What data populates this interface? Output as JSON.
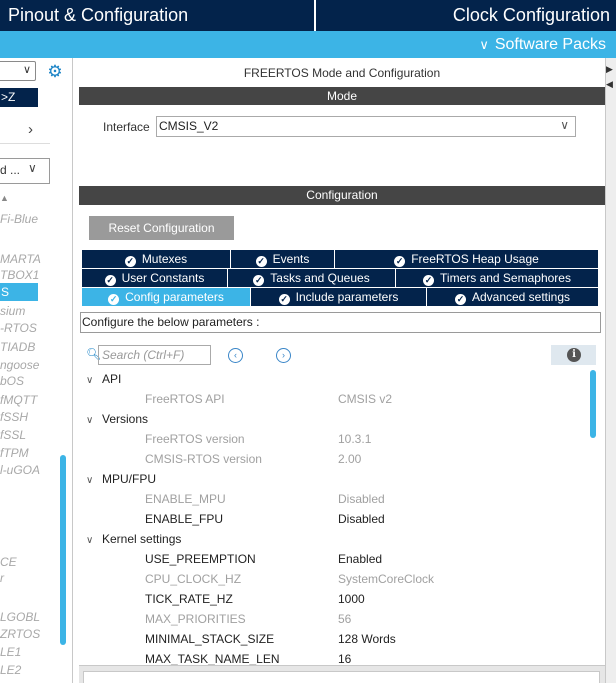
{
  "header": {
    "tab_pinout": "Pinout & Configuration",
    "tab_clock": "Clock Configuration",
    "software_packs": "Software Packs"
  },
  "left": {
    "sort_label": ">Z",
    "cat2_label": "d ...",
    "items": [
      "Fi-Blue",
      "MARTA",
      "TBOX1",
      "S",
      "sium",
      "-RTOS",
      "TIADB",
      "ngoose",
      "bOS",
      "fMQTT",
      "fSSH",
      "fSSL",
      "fTPM",
      "l-uGOA",
      "CE",
      "r",
      "LGOBL",
      "ZRTOS",
      "LE1",
      "LE2"
    ]
  },
  "mode": {
    "title": "FREERTOS Mode and Configuration",
    "bar_label": "Mode",
    "interface_label": "Interface",
    "interface_value": "CMSIS_V2"
  },
  "configuration": {
    "bar_label": "Configuration",
    "reset_button": "Reset Configuration",
    "tabs_row1": [
      "Mutexes",
      "Events",
      "FreeRTOS Heap Usage"
    ],
    "tabs_row2": [
      "User Constants",
      "Tasks and Queues",
      "Timers and Semaphores"
    ],
    "tabs_row3": [
      "Config parameters",
      "Include parameters",
      "Advanced settings"
    ],
    "params_label": "Configure the below parameters :",
    "search_placeholder": "Search (Ctrl+F)"
  },
  "tree": [
    {
      "group": "API",
      "params": [
        {
          "name": "FreeRTOS API",
          "value": "CMSIS v2",
          "active": false
        }
      ]
    },
    {
      "group": "Versions",
      "params": [
        {
          "name": "FreeRTOS version",
          "value": "10.3.1",
          "active": false
        },
        {
          "name": "CMSIS-RTOS version",
          "value": "2.00",
          "active": false
        }
      ]
    },
    {
      "group": "MPU/FPU",
      "params": [
        {
          "name": "ENABLE_MPU",
          "value": "Disabled",
          "active": false
        },
        {
          "name": "ENABLE_FPU",
          "value": "Disabled",
          "active": true
        }
      ]
    },
    {
      "group": "Kernel settings",
      "params": [
        {
          "name": "USE_PREEMPTION",
          "value": "Enabled",
          "active": true
        },
        {
          "name": "CPU_CLOCK_HZ",
          "value": "SystemCoreClock",
          "active": false
        },
        {
          "name": "TICK_RATE_HZ",
          "value": "1000",
          "active": true
        },
        {
          "name": "MAX_PRIORITIES",
          "value": "56",
          "active": false
        },
        {
          "name": "MINIMAL_STACK_SIZE",
          "value": "128 Words",
          "active": true
        },
        {
          "name": "MAX_TASK_NAME_LEN",
          "value": "16",
          "active": true
        }
      ]
    }
  ],
  "colors": {
    "navy": "#03234b",
    "accent": "#3cb4e6",
    "bar_gray": "#454545"
  }
}
